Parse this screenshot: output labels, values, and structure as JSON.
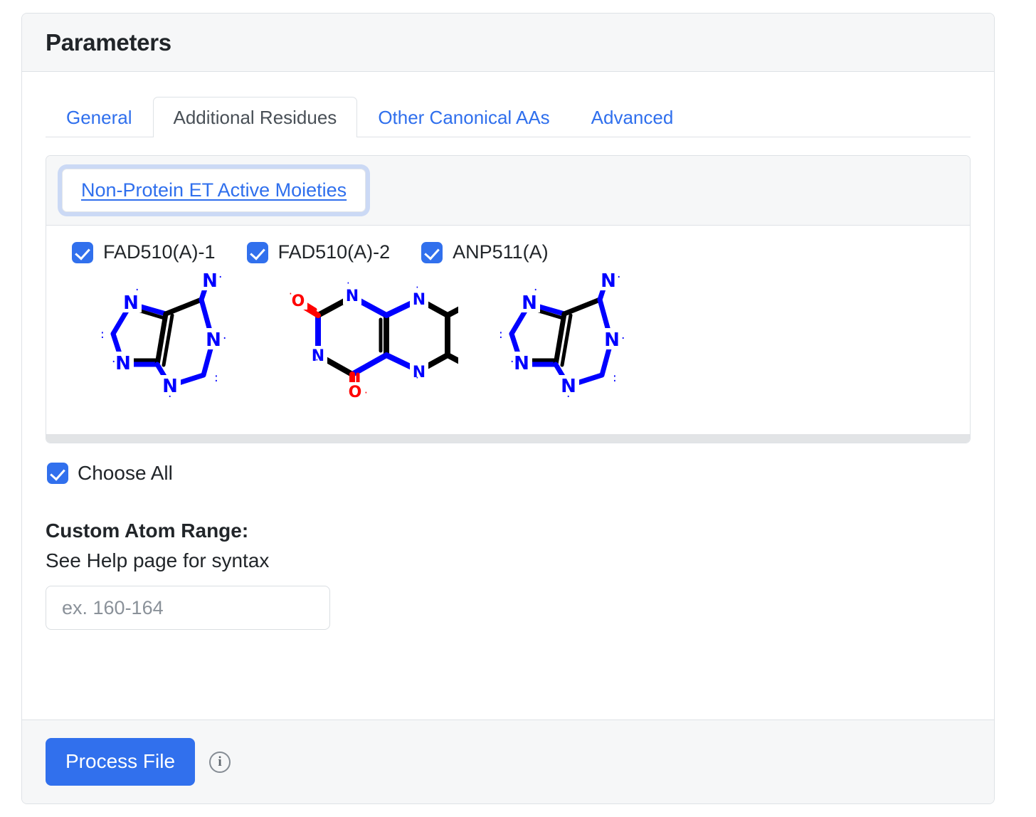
{
  "header": {
    "title": "Parameters"
  },
  "tabs": [
    {
      "label": "General",
      "active": false
    },
    {
      "label": "Additional Residues",
      "active": true
    },
    {
      "label": "Other Canonical AAs",
      "active": false
    },
    {
      "label": "Advanced",
      "active": false
    }
  ],
  "accordion": {
    "link_label": "Non-Protein ET Active Moieties"
  },
  "moieties": [
    {
      "label": "FAD510(A)-1",
      "checked": true,
      "structure": "purine"
    },
    {
      "label": "FAD510(A)-2",
      "checked": true,
      "structure": "isoalloxazine"
    },
    {
      "label": "ANP511(A)",
      "checked": true,
      "structure": "purine"
    }
  ],
  "choose_all": {
    "label": "Choose All",
    "checked": true
  },
  "custom_atom_range": {
    "title": "Custom Atom Range:",
    "subtitle": "See Help page for syntax",
    "placeholder": "ex. 160-164",
    "value": ""
  },
  "footer": {
    "process_label": "Process File",
    "info_glyph": "i"
  },
  "colors": {
    "accent": "#3170ed",
    "link": "#2f6fed",
    "border": "#dee2e6",
    "header_bg": "#f6f7f8",
    "nitrogen": "#0000ff",
    "oxygen": "#ff0000",
    "bond": "#000000"
  }
}
